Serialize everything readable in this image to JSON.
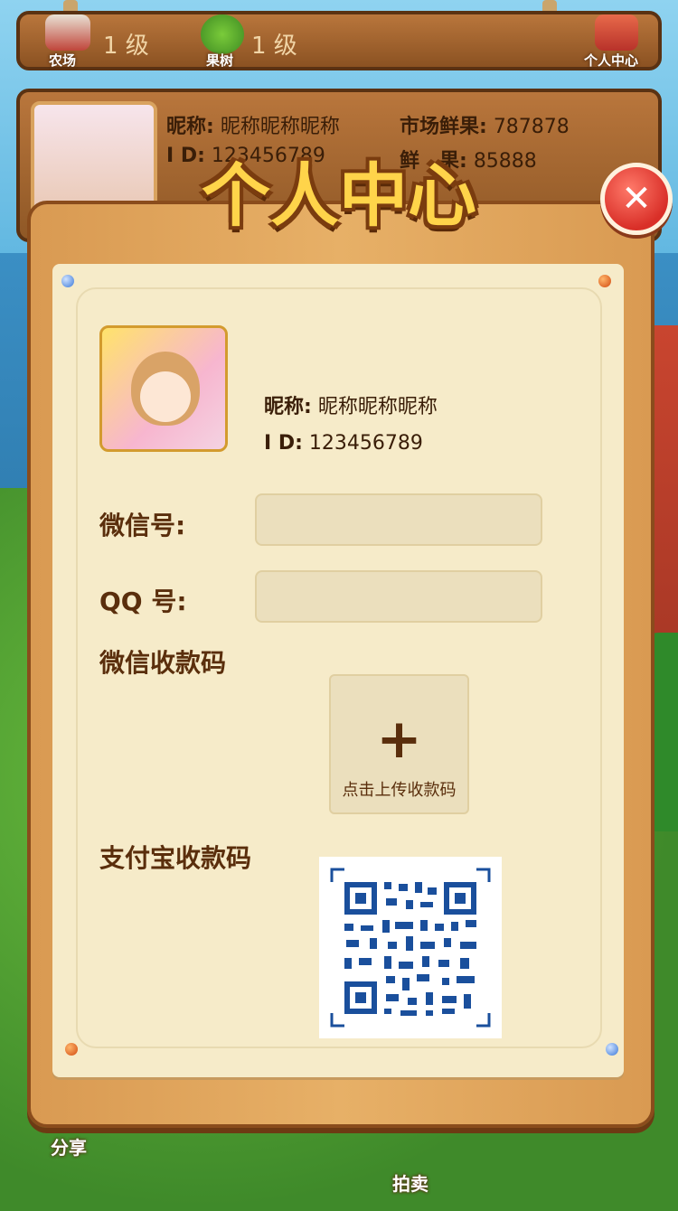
{
  "top_bar": {
    "farm": {
      "icon": "barn-icon",
      "label": "农场",
      "level": "1 级"
    },
    "orchard": {
      "icon": "fruit-tree-icon",
      "label": "果树",
      "level": "1 级"
    },
    "personal_center": {
      "icon": "house-icon",
      "label": "个人中心"
    }
  },
  "info_bar": {
    "nickname_label": "昵称:",
    "nickname": "昵称昵称昵称",
    "id_label": "I D:",
    "id": "123456789",
    "market_fruit_label": "市场鲜果:",
    "market_fruit": "787878",
    "fruit_label": "鲜　果:",
    "fruit": "85888"
  },
  "modal": {
    "title": "个人中心",
    "close_icon": "close-icon",
    "nickname_label": "昵称:",
    "nickname": "昵称昵称昵称",
    "id_label": "I D:",
    "id": "123456789",
    "wechat_label": "微信号:",
    "wechat_value": "",
    "qq_label": "QQ 号:",
    "qq_value": "",
    "wechat_pay_label": "微信收款码",
    "upload_text": "点击上传收款码",
    "alipay_label": "支付宝收款码"
  },
  "bottom_bar": {
    "share": "分享",
    "auction": "拍卖"
  },
  "colors": {
    "primary_text": "#5a2e0c",
    "title_fill": "#ffd44a",
    "close_red": "#d92f28",
    "paper": "#f6ebc9"
  }
}
